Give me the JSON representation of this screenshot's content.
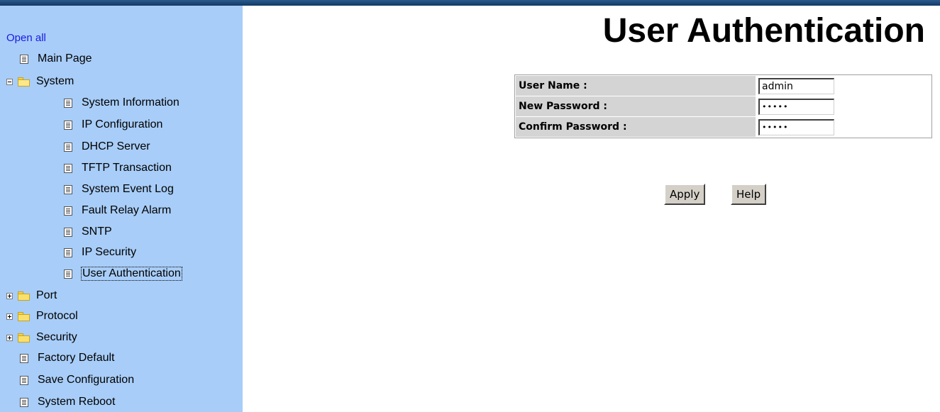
{
  "sidebar": {
    "open_all": "Open all",
    "items": [
      {
        "label": "Main Page"
      },
      {
        "label": "System"
      },
      {
        "label": "System Information"
      },
      {
        "label": "IP Configuration"
      },
      {
        "label": "DHCP Server"
      },
      {
        "label": "TFTP Transaction"
      },
      {
        "label": "System Event Log"
      },
      {
        "label": "Fault Relay Alarm"
      },
      {
        "label": "SNTP"
      },
      {
        "label": "IP Security"
      },
      {
        "label": "User Authentication"
      },
      {
        "label": "Port"
      },
      {
        "label": "Protocol"
      },
      {
        "label": "Security"
      },
      {
        "label": "Factory Default"
      },
      {
        "label": "Save Configuration"
      },
      {
        "label": "System Reboot"
      }
    ]
  },
  "main": {
    "title": "User Authentication",
    "form": {
      "user_name_label": "User Name :",
      "user_name_value": "admin",
      "new_password_label": "New Password :",
      "new_password_value": "admin",
      "confirm_password_label": "Confirm Password :",
      "confirm_password_value": "admin"
    },
    "buttons": {
      "apply": "Apply",
      "help": "Help"
    }
  },
  "colors": {
    "sidebar_bg": "#a8cdf8",
    "topbar": "#1f4d80",
    "link": "#1a1ae6",
    "label_cell_bg": "#d4d4d4",
    "button_bg": "#d4d0c8"
  },
  "icons": {
    "page": "document-icon",
    "folder_open": "folder-open-icon",
    "folder_closed": "folder-icon",
    "expand": "plus-box-icon",
    "collapse": "minus-box-icon"
  }
}
